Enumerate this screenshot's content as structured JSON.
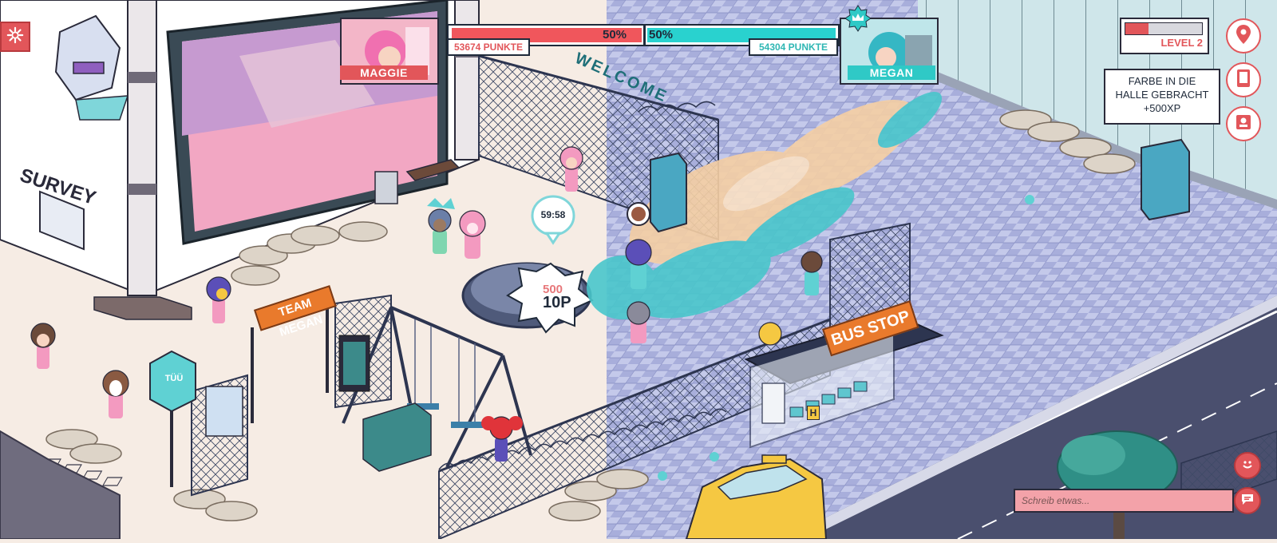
{
  "hud": {
    "player_left": {
      "name": "MAGGIE",
      "percent": "50%",
      "points": "53674 PUNKTE",
      "color": "#f0565c"
    },
    "player_right": {
      "name": "MEGAN",
      "percent": "50%",
      "points": "54304 PUNKTE",
      "color": "#29d2cf"
    },
    "level_label": "LEVEL 2",
    "level_progress": 0.3,
    "notification": {
      "line1": "FARBE IN DIE",
      "line2": "HALLE GEBRACHT",
      "line3": "+500XP"
    }
  },
  "side_buttons": [
    "map-pin-icon",
    "tablet-icon",
    "profile-card-icon"
  ],
  "settings_icon": "gear-icon",
  "world": {
    "banner_welcome": "WELCOME",
    "sign_survey": "SURVEY",
    "sign_team": "TEAM MEGAN",
    "sign_bus": "BUS STOP",
    "timer": "59:58",
    "capture_old_points": "500",
    "capture_points": "10P",
    "bus_stop_marker": "H",
    "kiosk_label": "TÜÜ"
  },
  "chat": {
    "placeholder": "Schreib etwas..."
  },
  "colors": {
    "accent_red": "#e2565a",
    "accent_teal": "#2fc9c6",
    "floor_blue": "#8f98c9"
  }
}
